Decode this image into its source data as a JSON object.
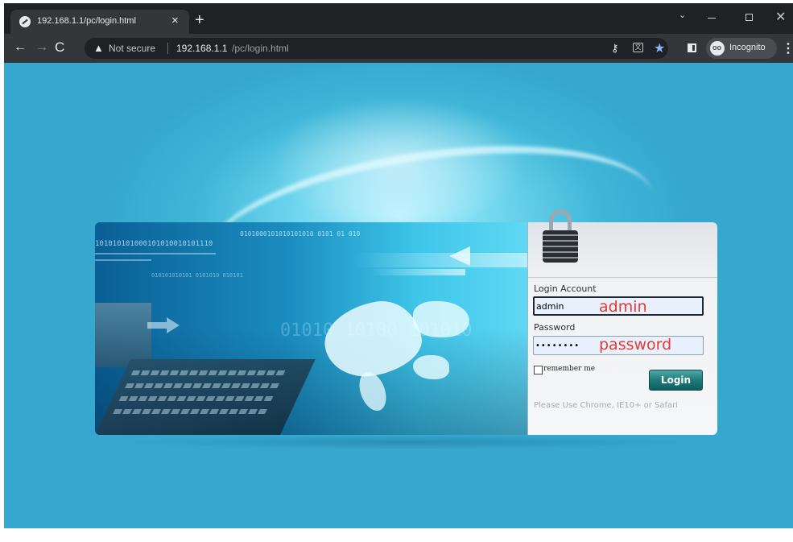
{
  "tab": {
    "title": "192.168.1.1/pc/login.html",
    "close_symbol": "×",
    "new_tab_symbol": "+"
  },
  "window_controls": {
    "chevron": "⌄",
    "close": "✕"
  },
  "toolbar": {
    "back": "←",
    "forward": "→",
    "reload": "C",
    "security_text": "Not secure",
    "url_host": "192.168.1.1",
    "url_path": "/pc/login.html",
    "incognito_label": "Incognito",
    "menu": "⋮",
    "translate_glyph": "文",
    "star": "★",
    "key": "⚷",
    "warning": "▲"
  },
  "banner": {
    "binary_top": "0101000101010101010   0101  01 010",
    "binary_left": "101010101000101010010101110",
    "binary_mid": "010101010101 0101010 010101",
    "binary_faint": "01010 10100 101010"
  },
  "login": {
    "account_label": "Login Account",
    "account_value": "admin",
    "password_label": "Password",
    "password_value": "••••••••",
    "annotation_account": "admin",
    "annotation_password": "password",
    "remember_label": "remember me",
    "remember_checked": false,
    "login_button": "Login",
    "browser_note": "Please Use Chrome, IE10+ or Safari"
  },
  "colors": {
    "page_background": "#36a8cf",
    "annotation_red": "#e23c2e",
    "login_button": "#1f7a79",
    "star_blue": "#8ab4f8"
  }
}
